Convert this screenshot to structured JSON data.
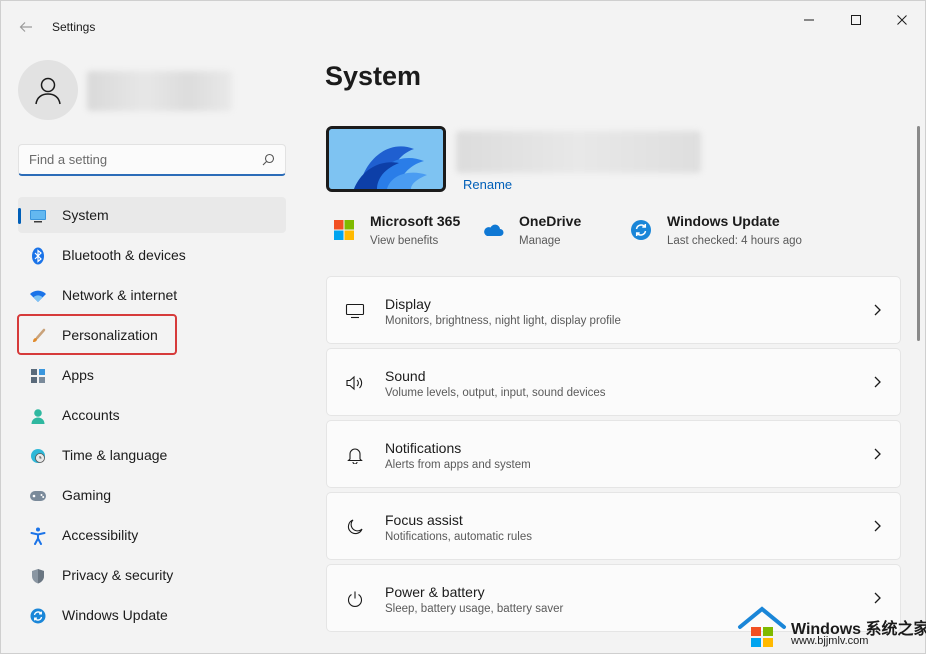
{
  "titlebar": {
    "title": "Settings"
  },
  "search": {
    "placeholder": "Find a setting"
  },
  "sidebar": {
    "items": [
      {
        "label": "System",
        "icon": "monitor-icon"
      },
      {
        "label": "Bluetooth & devices",
        "icon": "bluetooth-icon"
      },
      {
        "label": "Network & internet",
        "icon": "wifi-icon"
      },
      {
        "label": "Personalization",
        "icon": "brush-icon"
      },
      {
        "label": "Apps",
        "icon": "apps-icon"
      },
      {
        "label": "Accounts",
        "icon": "person-icon"
      },
      {
        "label": "Time & language",
        "icon": "globe-clock-icon"
      },
      {
        "label": "Gaming",
        "icon": "gamepad-icon"
      },
      {
        "label": "Accessibility",
        "icon": "accessibility-icon"
      },
      {
        "label": "Privacy & security",
        "icon": "shield-icon"
      },
      {
        "label": "Windows Update",
        "icon": "update-icon"
      }
    ]
  },
  "main": {
    "title": "System",
    "rename": "Rename",
    "quick": [
      {
        "title": "Microsoft 365",
        "sub": "View benefits"
      },
      {
        "title": "OneDrive",
        "sub": "Manage"
      },
      {
        "title": "Windows Update",
        "sub": "Last checked: 4 hours ago"
      }
    ],
    "cards": [
      {
        "title": "Display",
        "sub": "Monitors, brightness, night light, display profile"
      },
      {
        "title": "Sound",
        "sub": "Volume levels, output, input, sound devices"
      },
      {
        "title": "Notifications",
        "sub": "Alerts from apps and system"
      },
      {
        "title": "Focus assist",
        "sub": "Notifications, automatic rules"
      },
      {
        "title": "Power & battery",
        "sub": "Sleep, battery usage, battery saver"
      }
    ]
  },
  "watermark": {
    "line1": "Windows 系统之家",
    "line2": "www.bjjmlv.com"
  },
  "colors": {
    "accent": "#005fb8",
    "highlight": "#d63a3a"
  }
}
